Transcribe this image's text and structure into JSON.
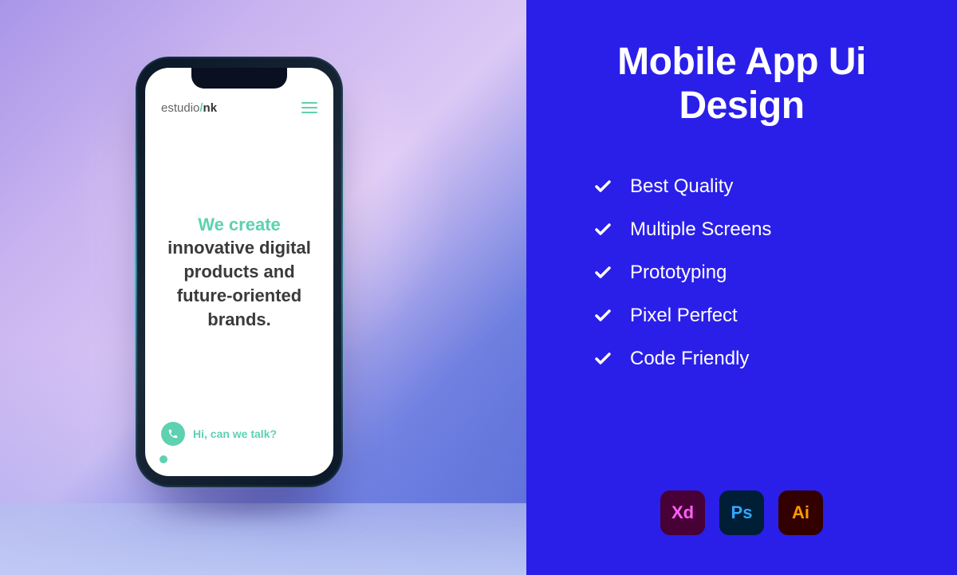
{
  "phone": {
    "logo_prefix": "estudio",
    "logo_slash": "/",
    "logo_suffix": "nk",
    "hero_accent": "We create",
    "hero_rest": "innovative digital products and future-oriented brands.",
    "chat_label": "Hi, can we talk?"
  },
  "panel": {
    "title": "Mobile App Ui Design",
    "features": [
      "Best Quality",
      "Multiple Screens",
      "Prototyping",
      "Pixel Perfect",
      "Code Friendly"
    ],
    "tools": {
      "xd": "Xd",
      "ps": "Ps",
      "ai": "Ai"
    }
  }
}
